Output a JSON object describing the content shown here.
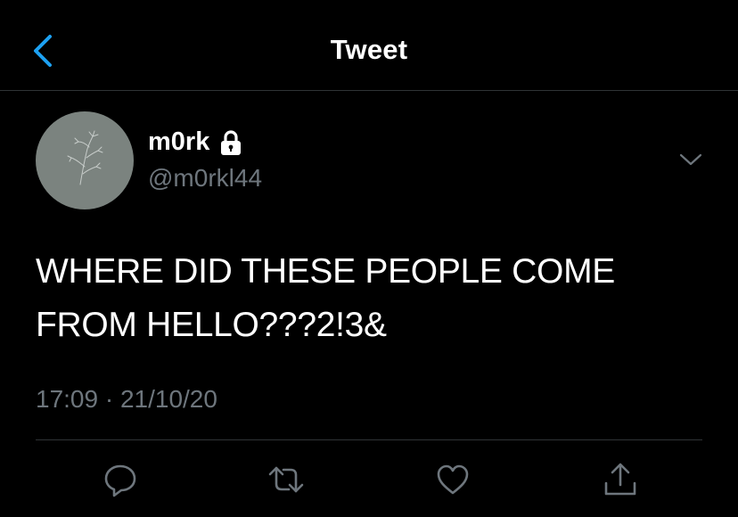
{
  "header": {
    "title": "Tweet",
    "back_icon": "chevron-left-icon",
    "accent_color": "#1da1f2"
  },
  "tweet": {
    "author_name": "m0rk",
    "author_handle": "@m0rkl44",
    "protected": true,
    "text": "WHERE DID THESE PEOPLE COME FROM HELLO???2!3&",
    "timestamp": "17:09 · 21/10/20"
  },
  "actions": [
    "reply-icon",
    "retweet-icon",
    "like-icon",
    "share-icon"
  ],
  "colors": {
    "background": "#000000",
    "secondary_text": "#6e767d",
    "divider": "#2f3336",
    "avatar_bg": "#7b837f"
  }
}
